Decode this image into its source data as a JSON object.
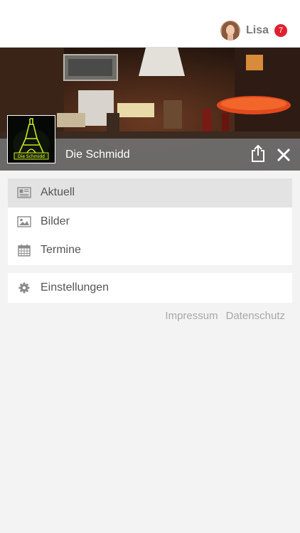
{
  "header": {
    "user_name": "Lisa",
    "notification_count": "7"
  },
  "venue": {
    "name": "Die Schmidd",
    "logo_text": "Die Schmidd"
  },
  "menu": {
    "primary": [
      {
        "label": "Aktuell",
        "icon": "newspaper-icon",
        "active": true
      },
      {
        "label": "Bilder",
        "icon": "image-icon",
        "active": false
      },
      {
        "label": "Termine",
        "icon": "calendar-icon",
        "active": false
      }
    ],
    "secondary": [
      {
        "label": "Einstellungen",
        "icon": "gear-icon",
        "active": false
      }
    ]
  },
  "footer": {
    "links": [
      "Impressum",
      "Datenschutz"
    ]
  },
  "colors": {
    "badge": "#e02030",
    "active_item": "#e3e3e3",
    "infobar": "#6e6e6e",
    "logo_neon": "#c8e61e"
  }
}
